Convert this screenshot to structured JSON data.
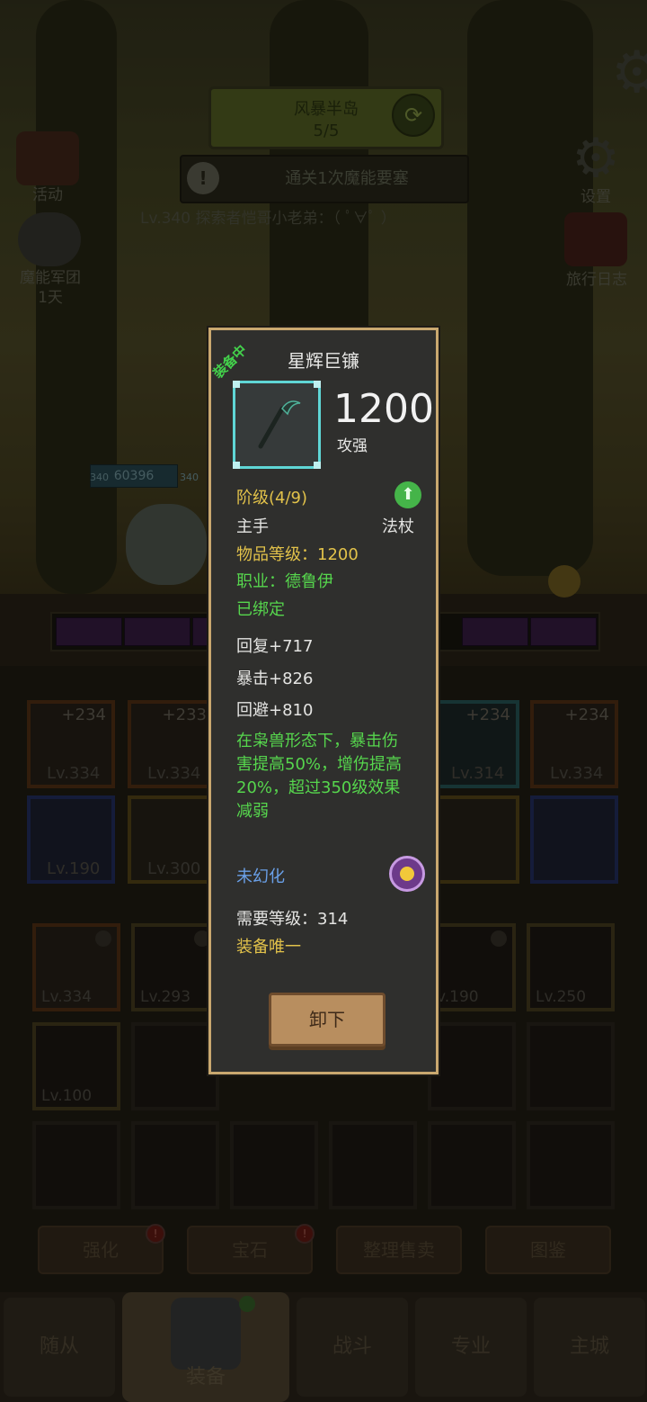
{
  "top": {
    "zone_name": "风暴半岛",
    "zone_progress": "5/5",
    "quest_text": "通关1次魔能要塞",
    "player_line": "Lv.340 探索者恺哥小老弟：（ ﾟ∀ﾟ ）",
    "left_menu": {
      "activity": "活动",
      "legion": "魔能军团",
      "legion_sub": "1天"
    },
    "right_menu": {
      "settings": "设置",
      "travel_log": "旅行日志"
    }
  },
  "hud": {
    "hp_value": "60396",
    "level_a": "340",
    "level_b": "340"
  },
  "equipped_slots": [
    {
      "plus": "+234",
      "lv": "Lv.334"
    },
    {
      "plus": "+233",
      "lv": "Lv.334"
    },
    {
      "plus": "+234",
      "lv": "Lv.314"
    },
    {
      "plus": "+234",
      "lv": "Lv.334"
    },
    {
      "lv": "Lv.190"
    },
    {
      "lv": "Lv.300"
    }
  ],
  "bag": [
    {
      "lv": "Lv.334"
    },
    {
      "lv": "Lv.293"
    },
    {
      "lv": "v.190"
    },
    {
      "lv": "Lv.250"
    },
    {
      "lv": "Lv.100"
    }
  ],
  "actions": {
    "enhance": "强化",
    "gem": "宝石",
    "sort_sell": "整理售卖",
    "catalog": "图鉴"
  },
  "tabs": {
    "follower": "随从",
    "equipment": "装备",
    "battle": "战斗",
    "profession": "专业",
    "city": "主城"
  },
  "popup": {
    "equipped_tag": "装备中",
    "title": "星辉巨镰",
    "power": "1200",
    "power_label": "攻强",
    "tier": "阶级(4/9)",
    "slot": "主手",
    "weapon_type": "法杖",
    "item_level": "物品等级：1200",
    "class": "职业：德鲁伊",
    "bound": "已绑定",
    "stats": [
      "回复+717",
      "暴击+826",
      "回避+810"
    ],
    "effect": "在枭兽形态下，暴击伤害提高50%，增伤提高20%，超过350级效果减弱",
    "transmog": "未幻化",
    "req_level": "需要等级：314",
    "unique": "装备唯一",
    "unequip_label": "卸下"
  },
  "colors": {
    "frame": "#c9a86f",
    "rarity": "#5fd6d6",
    "gold": "#e2c24a",
    "green": "#56d64d",
    "blue": "#6aa0e8"
  },
  "icons": [
    "scythe-icon",
    "gear-icon",
    "refresh-icon",
    "arrow-up-icon",
    "illusion-icon",
    "lock-icon",
    "alert-icon"
  ]
}
